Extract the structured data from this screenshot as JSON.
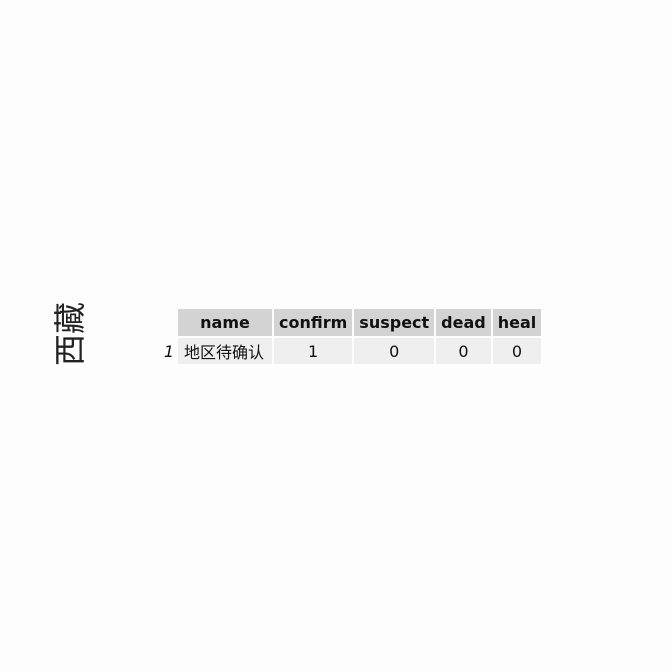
{
  "title": "西藏",
  "table": {
    "headers": [
      "name",
      "confirm",
      "suspect",
      "dead",
      "heal"
    ],
    "rows": [
      {
        "index": "1",
        "cells": [
          "地区待确认",
          "1",
          "0",
          "0",
          "0"
        ]
      }
    ]
  }
}
